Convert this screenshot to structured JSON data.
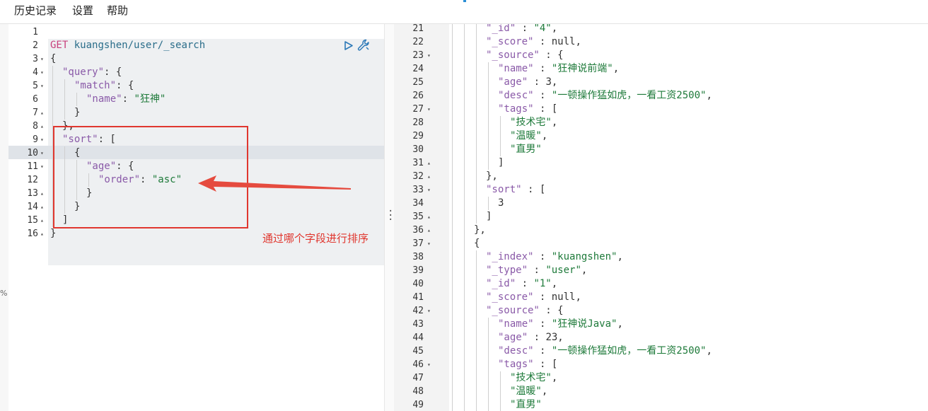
{
  "menu": {
    "history": "历史记录",
    "settings": "设置",
    "help": "帮助"
  },
  "icons": {
    "close": "✕",
    "run": "run-icon",
    "wrench": "wrench-icon"
  },
  "misc": {
    "percent": "%"
  },
  "annotation": "通过哪个字段进行排序",
  "colors": {
    "annotation": "#e0372f",
    "method": "#c8407c",
    "string": "#1e7a3a",
    "key": "#8a5aa8"
  },
  "editor": {
    "lines": [
      {
        "n": "1",
        "fold": "",
        "indent": 0,
        "tokens": []
      },
      {
        "n": "2",
        "fold": "",
        "indent": 0,
        "tokens": [
          {
            "t": "GET",
            "c": "m"
          },
          {
            "t": " kuangshen/user/_search",
            "c": "u"
          }
        ]
      },
      {
        "n": "3",
        "fold": "▾",
        "indent": 0,
        "tokens": [
          {
            "t": "{",
            "c": "p"
          }
        ]
      },
      {
        "n": "4",
        "fold": "▾",
        "indent": 1,
        "tokens": [
          {
            "t": "\"query\"",
            "c": "k"
          },
          {
            "t": ": {",
            "c": "p"
          }
        ]
      },
      {
        "n": "5",
        "fold": "▾",
        "indent": 2,
        "tokens": [
          {
            "t": "\"match\"",
            "c": "k"
          },
          {
            "t": ": {",
            "c": "p"
          }
        ]
      },
      {
        "n": "6",
        "fold": "",
        "indent": 3,
        "tokens": [
          {
            "t": "\"name\"",
            "c": "k"
          },
          {
            "t": ": ",
            "c": "p"
          },
          {
            "t": "\"狂神\"",
            "c": "s"
          }
        ]
      },
      {
        "n": "7",
        "fold": "▴",
        "indent": 2,
        "tokens": [
          {
            "t": "}",
            "c": "p"
          }
        ]
      },
      {
        "n": "8",
        "fold": "▴",
        "indent": 1,
        "tokens": [
          {
            "t": "},",
            "c": "p"
          }
        ]
      },
      {
        "n": "9",
        "fold": "▾",
        "indent": 1,
        "tokens": [
          {
            "t": "\"sort\"",
            "c": "k"
          },
          {
            "t": ": [",
            "c": "p"
          }
        ]
      },
      {
        "n": "10",
        "fold": "▾",
        "indent": 2,
        "tokens": [
          {
            "t": "{",
            "c": "p"
          }
        ]
      },
      {
        "n": "11",
        "fold": "▾",
        "indent": 3,
        "tokens": [
          {
            "t": "\"age\"",
            "c": "k"
          },
          {
            "t": ": {",
            "c": "p"
          }
        ]
      },
      {
        "n": "12",
        "fold": "",
        "indent": 4,
        "tokens": [
          {
            "t": "\"order\"",
            "c": "k"
          },
          {
            "t": ": ",
            "c": "p"
          },
          {
            "t": "\"asc\"",
            "c": "s"
          }
        ]
      },
      {
        "n": "13",
        "fold": "▴",
        "indent": 3,
        "tokens": [
          {
            "t": "}",
            "c": "p"
          }
        ]
      },
      {
        "n": "14",
        "fold": "▴",
        "indent": 2,
        "tokens": [
          {
            "t": "}",
            "c": "p"
          }
        ]
      },
      {
        "n": "15",
        "fold": "▴",
        "indent": 1,
        "tokens": [
          {
            "t": "]",
            "c": "p"
          }
        ]
      },
      {
        "n": "16",
        "fold": "▴",
        "indent": 0,
        "tokens": [
          {
            "t": "}",
            "c": "p"
          }
        ]
      }
    ]
  },
  "result": {
    "lines": [
      {
        "n": "21",
        "fold": "",
        "indent": 3,
        "tokens": [
          {
            "t": "\"_id\"",
            "c": "k"
          },
          {
            "t": " : ",
            "c": "p"
          },
          {
            "t": "\"4\"",
            "c": "s"
          },
          {
            "t": ",",
            "c": "p"
          }
        ]
      },
      {
        "n": "22",
        "fold": "",
        "indent": 3,
        "tokens": [
          {
            "t": "\"_score\"",
            "c": "k"
          },
          {
            "t": " : null,",
            "c": "p"
          }
        ]
      },
      {
        "n": "23",
        "fold": "▾",
        "indent": 3,
        "tokens": [
          {
            "t": "\"_source\"",
            "c": "k"
          },
          {
            "t": " : {",
            "c": "p"
          }
        ]
      },
      {
        "n": "24",
        "fold": "",
        "indent": 4,
        "tokens": [
          {
            "t": "\"name\"",
            "c": "k"
          },
          {
            "t": " : ",
            "c": "p"
          },
          {
            "t": "\"狂神说前端\"",
            "c": "s"
          },
          {
            "t": ",",
            "c": "p"
          }
        ]
      },
      {
        "n": "25",
        "fold": "",
        "indent": 4,
        "tokens": [
          {
            "t": "\"age\"",
            "c": "k"
          },
          {
            "t": " : 3,",
            "c": "p"
          }
        ]
      },
      {
        "n": "26",
        "fold": "",
        "indent": 4,
        "tokens": [
          {
            "t": "\"desc\"",
            "c": "k"
          },
          {
            "t": " : ",
            "c": "p"
          },
          {
            "t": "\"一顿操作猛如虎，一看工资2500\"",
            "c": "s"
          },
          {
            "t": ",",
            "c": "p"
          }
        ]
      },
      {
        "n": "27",
        "fold": "▾",
        "indent": 4,
        "tokens": [
          {
            "t": "\"tags\"",
            "c": "k"
          },
          {
            "t": " : [",
            "c": "p"
          }
        ]
      },
      {
        "n": "28",
        "fold": "",
        "indent": 5,
        "tokens": [
          {
            "t": "\"技术宅\"",
            "c": "s"
          },
          {
            "t": ",",
            "c": "p"
          }
        ]
      },
      {
        "n": "29",
        "fold": "",
        "indent": 5,
        "tokens": [
          {
            "t": "\"温暖\"",
            "c": "s"
          },
          {
            "t": ",",
            "c": "p"
          }
        ]
      },
      {
        "n": "30",
        "fold": "",
        "indent": 5,
        "tokens": [
          {
            "t": "\"直男\"",
            "c": "s"
          }
        ]
      },
      {
        "n": "31",
        "fold": "▴",
        "indent": 4,
        "tokens": [
          {
            "t": "]",
            "c": "p"
          }
        ]
      },
      {
        "n": "32",
        "fold": "▴",
        "indent": 3,
        "tokens": [
          {
            "t": "},",
            "c": "p"
          }
        ]
      },
      {
        "n": "33",
        "fold": "▾",
        "indent": 3,
        "tokens": [
          {
            "t": "\"sort\"",
            "c": "k"
          },
          {
            "t": " : [",
            "c": "p"
          }
        ]
      },
      {
        "n": "34",
        "fold": "",
        "indent": 4,
        "tokens": [
          {
            "t": "3",
            "c": "p"
          }
        ]
      },
      {
        "n": "35",
        "fold": "▴",
        "indent": 3,
        "tokens": [
          {
            "t": "]",
            "c": "p"
          }
        ]
      },
      {
        "n": "36",
        "fold": "▴",
        "indent": 2,
        "tokens": [
          {
            "t": "},",
            "c": "p"
          }
        ]
      },
      {
        "n": "37",
        "fold": "▾",
        "indent": 2,
        "tokens": [
          {
            "t": "{",
            "c": "p"
          }
        ]
      },
      {
        "n": "38",
        "fold": "",
        "indent": 3,
        "tokens": [
          {
            "t": "\"_index\"",
            "c": "k"
          },
          {
            "t": " : ",
            "c": "p"
          },
          {
            "t": "\"kuangshen\"",
            "c": "s"
          },
          {
            "t": ",",
            "c": "p"
          }
        ]
      },
      {
        "n": "39",
        "fold": "",
        "indent": 3,
        "tokens": [
          {
            "t": "\"_type\"",
            "c": "k"
          },
          {
            "t": " : ",
            "c": "p"
          },
          {
            "t": "\"user\"",
            "c": "s"
          },
          {
            "t": ",",
            "c": "p"
          }
        ]
      },
      {
        "n": "40",
        "fold": "",
        "indent": 3,
        "tokens": [
          {
            "t": "\"_id\"",
            "c": "k"
          },
          {
            "t": " : ",
            "c": "p"
          },
          {
            "t": "\"1\"",
            "c": "s"
          },
          {
            "t": ",",
            "c": "p"
          }
        ]
      },
      {
        "n": "41",
        "fold": "",
        "indent": 3,
        "tokens": [
          {
            "t": "\"_score\"",
            "c": "k"
          },
          {
            "t": " : null,",
            "c": "p"
          }
        ]
      },
      {
        "n": "42",
        "fold": "▾",
        "indent": 3,
        "tokens": [
          {
            "t": "\"_source\"",
            "c": "k"
          },
          {
            "t": " : {",
            "c": "p"
          }
        ]
      },
      {
        "n": "43",
        "fold": "",
        "indent": 4,
        "tokens": [
          {
            "t": "\"name\"",
            "c": "k"
          },
          {
            "t": " : ",
            "c": "p"
          },
          {
            "t": "\"狂神说Java\"",
            "c": "s"
          },
          {
            "t": ",",
            "c": "p"
          }
        ]
      },
      {
        "n": "44",
        "fold": "",
        "indent": 4,
        "tokens": [
          {
            "t": "\"age\"",
            "c": "k"
          },
          {
            "t": " : 23,",
            "c": "p"
          }
        ]
      },
      {
        "n": "45",
        "fold": "",
        "indent": 4,
        "tokens": [
          {
            "t": "\"desc\"",
            "c": "k"
          },
          {
            "t": " : ",
            "c": "p"
          },
          {
            "t": "\"一顿操作猛如虎，一看工资2500\"",
            "c": "s"
          },
          {
            "t": ",",
            "c": "p"
          }
        ]
      },
      {
        "n": "46",
        "fold": "▾",
        "indent": 4,
        "tokens": [
          {
            "t": "\"tags\"",
            "c": "k"
          },
          {
            "t": " : [",
            "c": "p"
          }
        ]
      },
      {
        "n": "47",
        "fold": "",
        "indent": 5,
        "tokens": [
          {
            "t": "\"技术宅\"",
            "c": "s"
          },
          {
            "t": ",",
            "c": "p"
          }
        ]
      },
      {
        "n": "48",
        "fold": "",
        "indent": 5,
        "tokens": [
          {
            "t": "\"温暖\"",
            "c": "s"
          },
          {
            "t": ",",
            "c": "p"
          }
        ]
      },
      {
        "n": "49",
        "fold": "",
        "indent": 5,
        "tokens": [
          {
            "t": "\"直男\"",
            "c": "s"
          }
        ]
      }
    ]
  }
}
